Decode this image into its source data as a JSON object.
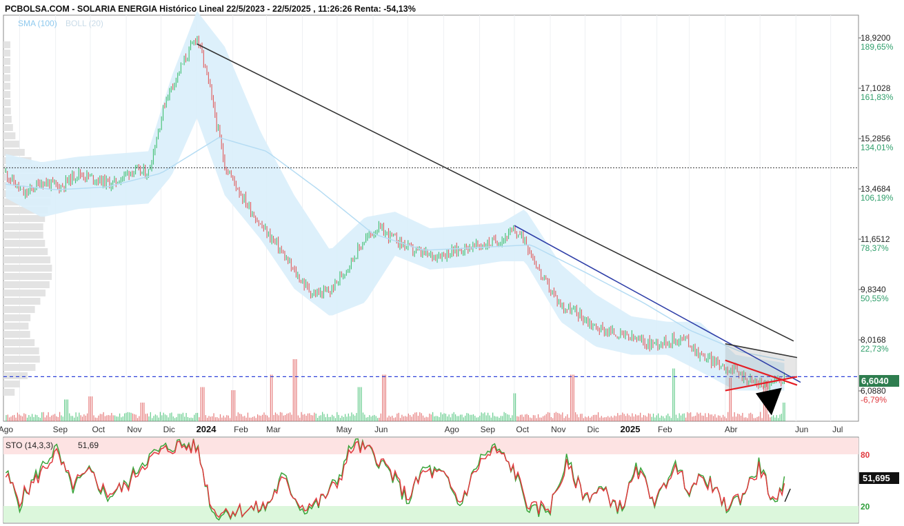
{
  "header": {
    "title": "PCBOLSA.COM - SOLARIA ENERGIA Histórico Lineal 22/5/2023 - 22/5/2025 , 11:26:26 Renta: -54,13%",
    "legend_sma": "SMA (100)",
    "legend_boll": "BOLL (20)"
  },
  "colors": {
    "up": "#3fbf6f",
    "down": "#e05a5a",
    "band_fill": "#d9eefb",
    "sma": "#b5dcf3",
    "trend_dark": "#333333",
    "trend_blue": "#2f3fa8",
    "trend_red": "#e51c23",
    "current_line": "#2b3fd8",
    "sto_k": "#3aa43a",
    "sto_d": "#e0393e",
    "overbought_zone": "#fde3e3",
    "oversold_zone": "#dcf7dc"
  },
  "price_axis": {
    "levels": [
      {
        "price": "18,9200",
        "pct": "189,65%",
        "sign": "pos"
      },
      {
        "price": "17,1028",
        "pct": "161,83%",
        "sign": "pos"
      },
      {
        "price": "15,2856",
        "pct": "134,01%",
        "sign": "pos"
      },
      {
        "price": "13,4684",
        "pct": "106,19%",
        "sign": "pos"
      },
      {
        "price": "11,6512",
        "pct": "78,37%",
        "sign": "pos"
      },
      {
        "price": "9,8340",
        "pct": "50,55%",
        "sign": "pos"
      },
      {
        "price": "8,0168",
        "pct": "22,73%",
        "sign": "pos"
      },
      {
        "price": "6,0880",
        "pct": "-6,79%",
        "sign": "neg"
      }
    ],
    "current_price": "6,6040"
  },
  "time_axis": {
    "labels": [
      {
        "text": "Ago",
        "year": false
      },
      {
        "text": "Sep",
        "year": false
      },
      {
        "text": "Oct",
        "year": false
      },
      {
        "text": "Nov",
        "year": false
      },
      {
        "text": "Dic",
        "year": false
      },
      {
        "text": "2024",
        "year": true
      },
      {
        "text": "Feb",
        "year": false
      },
      {
        "text": "Mar",
        "year": false
      },
      {
        "text": "May",
        "year": false
      },
      {
        "text": "Jun",
        "year": false
      },
      {
        "text": "Ago",
        "year": false
      },
      {
        "text": "Sep",
        "year": false
      },
      {
        "text": "Oct",
        "year": false
      },
      {
        "text": "Nov",
        "year": false
      },
      {
        "text": "Dic",
        "year": false
      },
      {
        "text": "2025",
        "year": true
      },
      {
        "text": "Feb",
        "year": false
      },
      {
        "text": "Abr",
        "year": false
      },
      {
        "text": "Jun",
        "year": false
      },
      {
        "text": "Jul",
        "year": false
      }
    ]
  },
  "stochastic": {
    "label": "STO (14,3,3)",
    "value": "51,69",
    "badge": "51,695",
    "level_high": "80",
    "level_low": "20"
  },
  "chart_data": [
    {
      "type": "line",
      "x_axis": "date",
      "y_axis": "price (EUR)",
      "ylim": [
        5.4,
        20.0
      ],
      "price_series": {
        "dates": [
          "2023-07-20",
          "2023-08-05",
          "2023-08-20",
          "2023-09-05",
          "2023-09-20",
          "2023-10-05",
          "2023-10-20",
          "2023-11-05",
          "2023-11-20",
          "2023-12-05",
          "2023-12-20",
          "2024-01-01",
          "2024-01-10",
          "2024-01-25",
          "2024-02-10",
          "2024-02-25",
          "2024-03-10",
          "2024-03-25",
          "2024-04-10",
          "2024-04-25",
          "2024-05-10",
          "2024-05-25",
          "2024-06-05",
          "2024-06-20",
          "2024-07-05",
          "2024-07-20",
          "2024-08-05",
          "2024-08-20",
          "2024-09-05",
          "2024-09-20",
          "2024-10-01",
          "2024-10-10",
          "2024-10-25",
          "2024-11-10",
          "2024-11-25",
          "2024-12-10",
          "2024-12-25",
          "2025-01-10",
          "2025-01-25",
          "2025-02-10",
          "2025-02-25",
          "2025-03-10",
          "2025-03-25",
          "2025-04-10",
          "2025-04-25",
          "2025-05-10",
          "2025-05-22"
        ],
        "close": [
          14.0,
          13.2,
          13.7,
          13.5,
          14.0,
          13.8,
          13.6,
          14.1,
          14.0,
          16.7,
          18.0,
          19.0,
          17.5,
          14.3,
          13.1,
          12.1,
          11.4,
          10.4,
          9.6,
          9.7,
          10.6,
          11.6,
          12.0,
          11.6,
          11.2,
          11.0,
          11.1,
          11.3,
          11.4,
          11.6,
          11.9,
          11.6,
          10.2,
          9.2,
          8.9,
          8.4,
          8.2,
          8.0,
          7.8,
          7.9,
          8.0,
          7.4,
          7.1,
          6.8,
          6.4,
          6.3,
          6.6
        ]
      },
      "sma100": {
        "dates": [
          "2023-07-20",
          "2023-09-01",
          "2023-10-15",
          "2023-12-01",
          "2024-01-20",
          "2024-03-01",
          "2024-04-15",
          "2024-06-01",
          "2024-07-15",
          "2024-09-01",
          "2024-10-15",
          "2024-12-01",
          "2025-01-20",
          "2025-03-01",
          "2025-04-15",
          "2025-05-22"
        ],
        "values": [
          13.6,
          13.4,
          13.5,
          14.0,
          15.3,
          14.8,
          13.4,
          11.8,
          11.2,
          11.3,
          11.4,
          10.4,
          9.3,
          8.3,
          7.5,
          7.2
        ]
      },
      "bollinger": {
        "dates": [
          "2023-07-20",
          "2023-08-20",
          "2023-09-20",
          "2023-10-20",
          "2023-11-20",
          "2023-12-10",
          "2024-01-01",
          "2024-01-25",
          "2024-02-25",
          "2024-03-25",
          "2024-04-25",
          "2024-05-25",
          "2024-06-20",
          "2024-07-20",
          "2024-08-20",
          "2024-09-20",
          "2024-10-10",
          "2024-11-10",
          "2024-12-10",
          "2025-01-10",
          "2025-02-10",
          "2025-03-10",
          "2025-04-10",
          "2025-05-22"
        ],
        "upper": [
          14.7,
          14.4,
          14.6,
          14.7,
          14.8,
          17.5,
          19.9,
          18.6,
          15.5,
          13.2,
          11.2,
          12.4,
          12.6,
          12.0,
          12.1,
          12.2,
          12.7,
          10.7,
          9.6,
          8.8,
          8.6,
          8.6,
          7.4,
          7.1
        ],
        "lower": [
          13.1,
          12.4,
          12.7,
          12.8,
          12.9,
          13.9,
          16.0,
          13.2,
          11.6,
          9.8,
          8.8,
          9.3,
          11.0,
          10.5,
          10.6,
          10.8,
          10.8,
          8.6,
          7.7,
          7.4,
          7.4,
          6.8,
          6.1,
          6.1
        ]
      },
      "trendlines": [
        {
          "name": "",
          "from": [
            "2024-01-01",
            18.7
          ],
          "to": [
            "2025-05-30",
            7.9
          ],
          "color": "dark"
        },
        {
          "name": "",
          "from": [
            "2024-10-01",
            12.1
          ],
          "to": [
            "2025-06-05",
            6.4
          ],
          "color": "blue"
        },
        {
          "name": "",
          "from": [
            "2025-04-01",
            7.8
          ],
          "to": [
            "2025-06-02",
            7.3
          ],
          "color": "dark"
        },
        {
          "name": "",
          "from": [
            "2025-04-01",
            7.2
          ],
          "to": [
            "2025-06-02",
            6.3
          ],
          "color": "red"
        },
        {
          "name": "",
          "from": [
            "2025-04-01",
            6.1
          ],
          "to": [
            "2025-06-02",
            6.6
          ],
          "color": "red"
        }
      ],
      "horizontal_dotted": 14.2,
      "current_price_level": 6.604,
      "volume": {
        "dates": [
          "2023-09-10",
          "2023-10-01",
          "2023-11-15",
          "2024-01-05",
          "2024-02-01",
          "2024-03-05",
          "2024-03-25",
          "2024-05-20",
          "2024-06-10",
          "2024-10-01",
          "2024-11-20",
          "2025-02-15",
          "2025-04-05",
          "2025-05-05",
          "2025-05-22"
        ],
        "relative": [
          0.35,
          0.4,
          0.3,
          0.55,
          0.5,
          0.75,
          1.0,
          0.55,
          0.75,
          0.45,
          0.75,
          0.85,
          0.7,
          0.65,
          0.3
        ]
      }
    },
    {
      "type": "line",
      "name": "STO (14,3,3)",
      "ylim": [
        0,
        100
      ],
      "levels": [
        20,
        80
      ],
      "dates": [
        "2023-07-20",
        "2023-08-01",
        "2023-08-15",
        "2023-09-01",
        "2023-09-15",
        "2023-10-01",
        "2023-10-15",
        "2023-11-01",
        "2023-11-15",
        "2023-12-01",
        "2023-12-15",
        "2024-01-01",
        "2024-01-15",
        "2024-02-01",
        "2024-02-15",
        "2024-03-01",
        "2024-03-15",
        "2024-04-01",
        "2024-04-15",
        "2024-05-01",
        "2024-05-15",
        "2024-06-01",
        "2024-06-15",
        "2024-07-01",
        "2024-07-15",
        "2024-08-01",
        "2024-08-15",
        "2024-09-01",
        "2024-09-15",
        "2024-10-01",
        "2024-10-15",
        "2024-11-01",
        "2024-11-15",
        "2024-12-01",
        "2024-12-15",
        "2025-01-01",
        "2025-01-15",
        "2025-02-01",
        "2025-02-15",
        "2025-03-01",
        "2025-03-15",
        "2025-04-01",
        "2025-04-15",
        "2025-05-01",
        "2025-05-15",
        "2025-05-22"
      ],
      "k": [
        60,
        22,
        55,
        88,
        40,
        60,
        30,
        45,
        72,
        85,
        92,
        90,
        10,
        14,
        16,
        18,
        55,
        16,
        22,
        50,
        95,
        80,
        60,
        25,
        65,
        55,
        20,
        75,
        88,
        60,
        12,
        18,
        72,
        30,
        40,
        15,
        65,
        22,
        70,
        40,
        55,
        18,
        30,
        70,
        12,
        60
      ],
      "d": [
        55,
        28,
        50,
        82,
        45,
        58,
        35,
        42,
        68,
        82,
        90,
        88,
        14,
        15,
        16,
        20,
        50,
        20,
        24,
        46,
        90,
        82,
        62,
        30,
        60,
        55,
        24,
        70,
        85,
        62,
        16,
        20,
        66,
        32,
        38,
        18,
        60,
        25,
        65,
        42,
        52,
        20,
        32,
        65,
        16,
        52
      ]
    }
  ]
}
